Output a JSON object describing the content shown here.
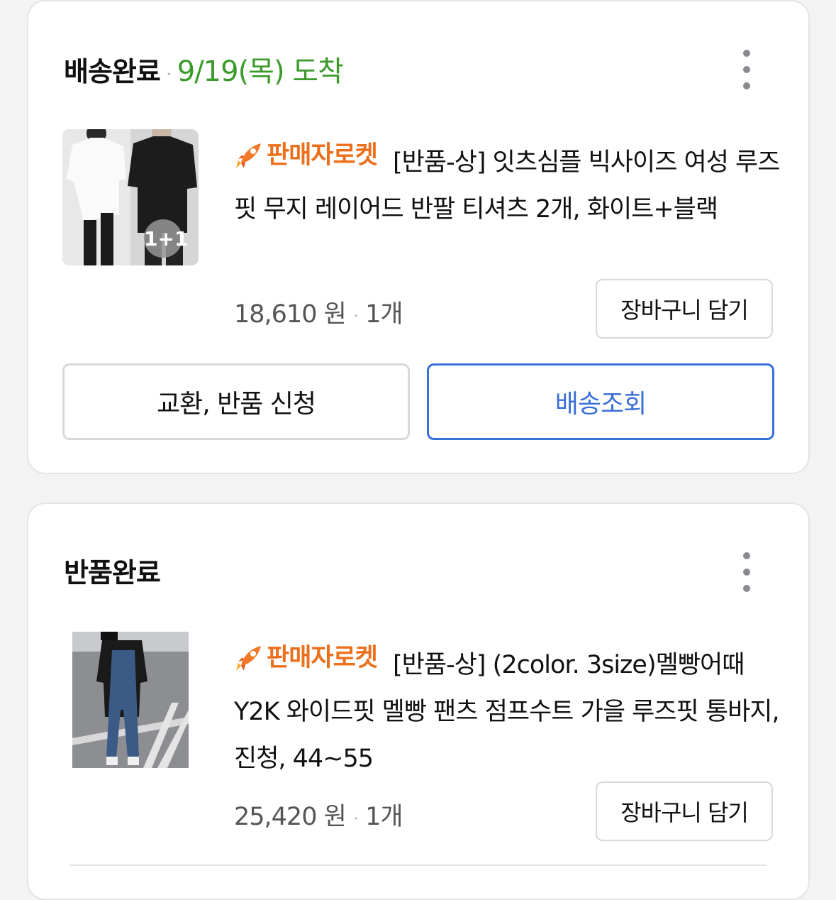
{
  "orders": [
    {
      "status": "배송완료",
      "arrival": "9/19(목) 도착",
      "badge": "판매자로켓",
      "title": "[반품-상] 잇츠심플 빅사이즈 여성 루즈핏 무지 레이어드 반팔 티셔츠 2개, 화이트+블랙",
      "price": "18,610 원",
      "qty": "1개",
      "thumb_label": "1+1",
      "cart_button": "장바구니 담기",
      "exchange_button": "교환, 반품 신청",
      "track_button": "배송조회"
    },
    {
      "status": "반품완료",
      "badge": "판매자로켓",
      "title": "[반품-상] (2color. 3size)멜빵어때 Y2K 와이드핏 멜빵 팬츠 점프수트 가을 루즈핏 통바지, 진청, 44~55",
      "price": "25,420 원",
      "qty": "1개",
      "cart_button": "장바구니 담기"
    }
  ],
  "icons": {
    "kebab": "more-vertical-icon",
    "rocket": "rocket-icon"
  },
  "colors": {
    "arrival": "#3b9b2a",
    "badge": "#ec6f1b",
    "track": "#3a6fd8"
  }
}
